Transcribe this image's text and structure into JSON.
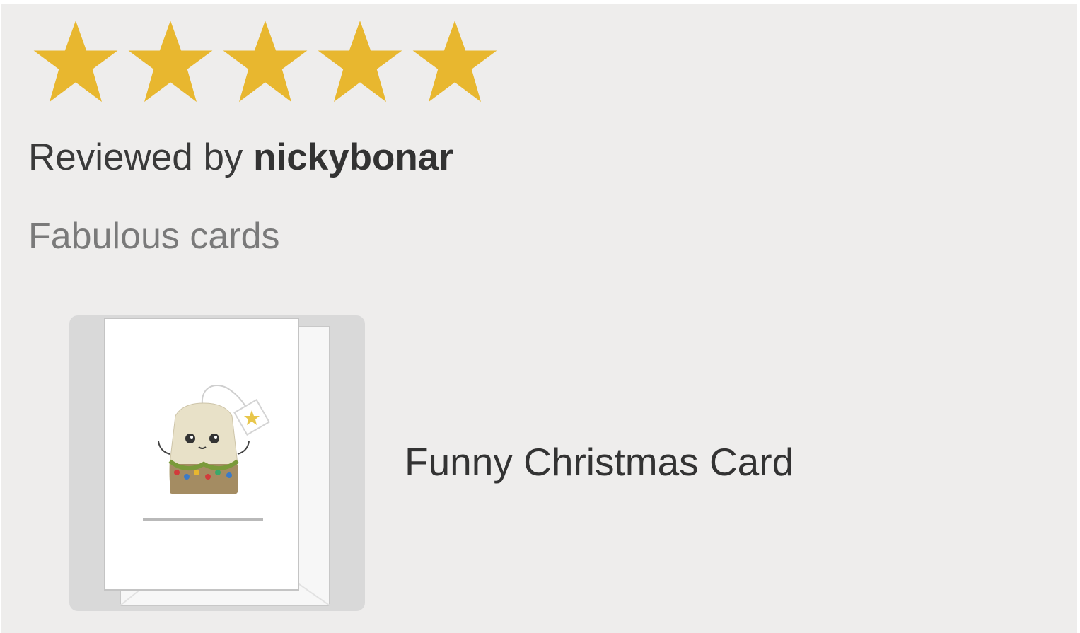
{
  "review": {
    "rating": 5,
    "rating_max": 5,
    "star_icon": "star-icon",
    "star_color": "#e8b72f",
    "reviewed_by_prefix": "Reviewed by ",
    "reviewer_name": "nickybonar",
    "text": "Fabulous cards"
  },
  "product": {
    "title": "Funny Christmas Card",
    "image_icon": "christmas-tea-bag-card-image"
  },
  "colors": {
    "background": "#eeedec",
    "thumbnail_bg": "#d9d9d9",
    "text_primary": "#333333",
    "text_secondary": "#7a7a7a"
  }
}
